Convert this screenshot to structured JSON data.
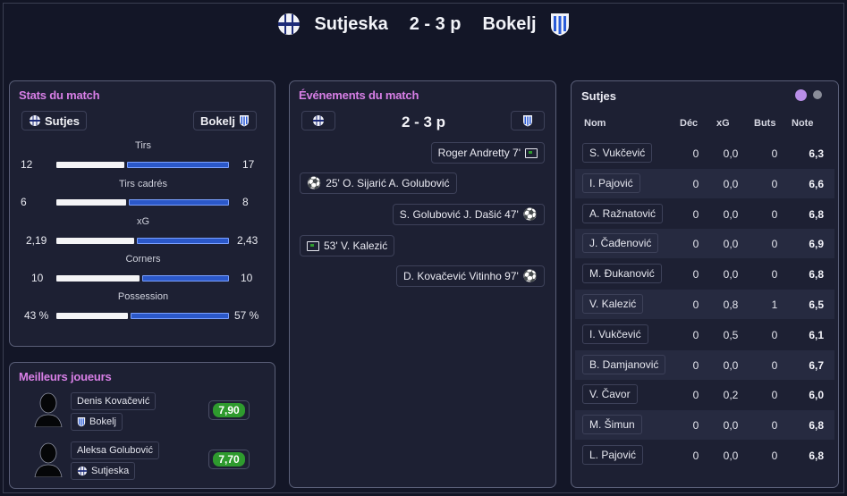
{
  "header": {
    "home_team": "Sutjeska",
    "score": "2 - 3 p",
    "away_team": "Bokelj",
    "home_crest": "sutjeska-crest-icon",
    "away_crest": "bokelj-crest-icon"
  },
  "stats": {
    "title": "Stats du match",
    "home_label": "Sutjes",
    "away_label": "Bokelj",
    "rows": [
      {
        "label": "Tirs",
        "home": "12",
        "away": "17"
      },
      {
        "label": "Tirs cadrés",
        "home": "6",
        "away": "8"
      },
      {
        "label": "xG",
        "home": "2,19",
        "away": "2,43"
      },
      {
        "label": "Corners",
        "home": "10",
        "away": "10"
      },
      {
        "label": "Possession",
        "home": "43 %",
        "away": "57 %"
      }
    ]
  },
  "best": {
    "title": "Meilleurs joueurs",
    "players": [
      {
        "name": "Denis Kovačević",
        "team": "Bokelj",
        "rating": "7,90"
      },
      {
        "name": "Aleksa Golubović",
        "team": "Sutjeska",
        "rating": "7,70"
      }
    ]
  },
  "events": {
    "title": "Événements du match",
    "score": "2 - 3 p",
    "items": [
      {
        "text": "Roger Andretty 7'",
        "icon": "yellow-card-icon",
        "side": "away"
      },
      {
        "text": "25' O. Sijarić A. Golubović",
        "icon": "goal-ball-icon",
        "side": "home"
      },
      {
        "text": "S. Golubović J. Dašić 47'",
        "icon": "goal-ball-icon",
        "side": "away"
      },
      {
        "text": "53' V. Kalezić",
        "icon": "yellow-card-icon",
        "side": "home"
      },
      {
        "text": "D. Kovačević Vitinho 97'",
        "icon": "goal-ball-icon",
        "side": "away"
      }
    ]
  },
  "squad": {
    "title": "Sutjes",
    "headers": {
      "name": "Nom",
      "dec": "Déc",
      "xg": "xG",
      "goals": "Buts",
      "note": "Note"
    },
    "dot_active": "#b98ee8",
    "dot_inactive": "#8a8d99",
    "players": [
      {
        "name": "S. Vukčević",
        "dec": "0",
        "xg": "0,0",
        "goals": "0",
        "note": "6,3"
      },
      {
        "name": "I. Pajović",
        "dec": "0",
        "xg": "0,0",
        "goals": "0",
        "note": "6,6"
      },
      {
        "name": "A. Ražnatović",
        "dec": "0",
        "xg": "0,0",
        "goals": "0",
        "note": "6,8"
      },
      {
        "name": "J. Čađenović",
        "dec": "0",
        "xg": "0,0",
        "goals": "0",
        "note": "6,9"
      },
      {
        "name": "M. Đukanović",
        "dec": "0",
        "xg": "0,0",
        "goals": "0",
        "note": "6,8"
      },
      {
        "name": "V. Kalezić",
        "dec": "0",
        "xg": "0,8",
        "goals": "1",
        "note": "6,5"
      },
      {
        "name": "I. Vukčević",
        "dec": "0",
        "xg": "0,5",
        "goals": "0",
        "note": "6,1"
      },
      {
        "name": "B. Damjanović",
        "dec": "0",
        "xg": "0,0",
        "goals": "0",
        "note": "6,7"
      },
      {
        "name": "V. Čavor",
        "dec": "0",
        "xg": "0,2",
        "goals": "0",
        "note": "6,0"
      },
      {
        "name": "M. Šimun",
        "dec": "0",
        "xg": "0,0",
        "goals": "0",
        "note": "6,8"
      },
      {
        "name": "L. Pajović",
        "dec": "0",
        "xg": "0,0",
        "goals": "0",
        "note": "6,8"
      }
    ]
  },
  "colors": {
    "accent_title": "#d87fe6",
    "bar_home": "#f4f4f6",
    "bar_away": "#2b58c9",
    "rating_green": "#2e9a2e"
  }
}
